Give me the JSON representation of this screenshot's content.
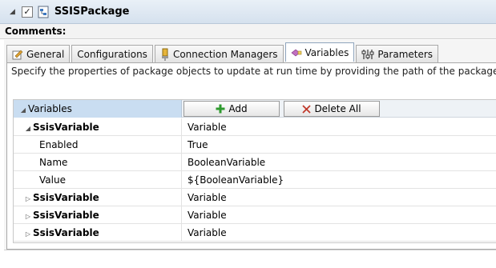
{
  "package": {
    "title": "SSISPackage",
    "checked": true
  },
  "comments_label": "Comments:",
  "tabs": [
    {
      "label": "General",
      "icon": "general-icon",
      "active": false
    },
    {
      "label": "Configurations",
      "icon": "",
      "active": false
    },
    {
      "label": "Connection Managers",
      "icon": "connection-managers-icon",
      "active": false
    },
    {
      "label": "Variables",
      "icon": "variables-icon",
      "active": true
    },
    {
      "label": "Parameters",
      "icon": "parameters-icon",
      "active": false
    }
  ],
  "description": "Specify the properties of package objects to update at run time by providing the path of the package objects",
  "grid": {
    "header": "Variables",
    "add_label": "Add",
    "delete_all_label": "Delete All",
    "rows": [
      {
        "name": "SsisVariable",
        "value": "Variable",
        "expanded": true,
        "child": false
      },
      {
        "name": "Enabled",
        "value": "True",
        "child": true
      },
      {
        "name": "Name",
        "value": "BooleanVariable",
        "child": true
      },
      {
        "name": "Value",
        "value": "${BooleanVariable}",
        "child": true
      },
      {
        "name": "SsisVariable",
        "value": "Variable",
        "expanded": false,
        "child": false
      },
      {
        "name": "SsisVariable",
        "value": "Variable",
        "expanded": false,
        "child": false
      },
      {
        "name": "SsisVariable",
        "value": "Variable",
        "expanded": false,
        "child": false
      }
    ]
  },
  "colors": {
    "header_bg": "#dbe6f1",
    "grid_header_selected": "#c9ddf1",
    "add_icon": "#2e9a2e",
    "delete_icon": "#c0392b"
  }
}
